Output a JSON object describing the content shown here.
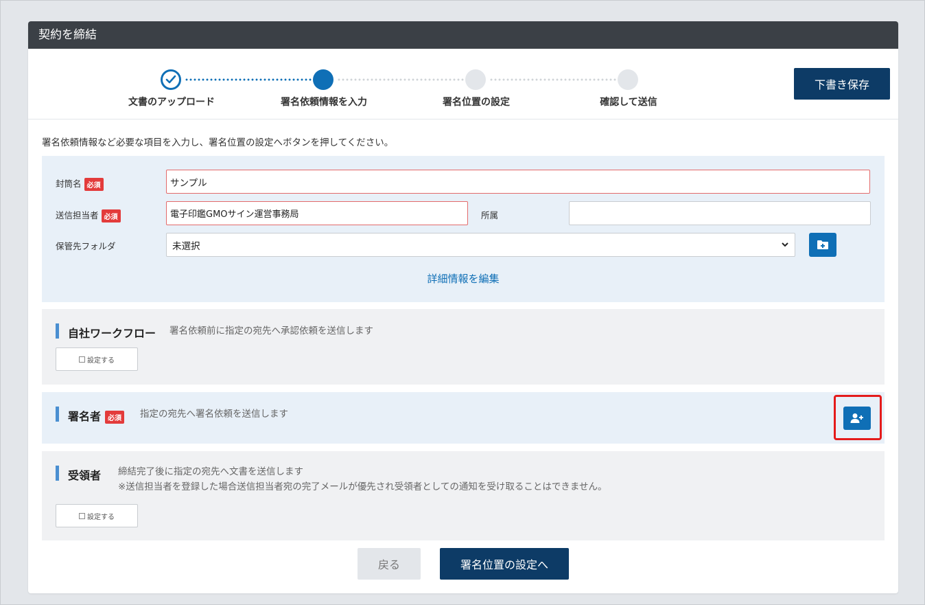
{
  "window": {
    "title": "契約を締結"
  },
  "stepper": {
    "steps": [
      {
        "label": "文書のアップロード",
        "state": "done"
      },
      {
        "label": "署名依頼情報を入力",
        "state": "active"
      },
      {
        "label": "署名位置の設定",
        "state": "pending"
      },
      {
        "label": "確認して送信",
        "state": "pending"
      }
    ]
  },
  "toolbar": {
    "draft_save_label": "下書き保存"
  },
  "instruction": "署名依頼情報など必要な項目を入力し、署名位置の設定へボタンを押してください。",
  "form": {
    "envelope_name": {
      "label": "封筒名",
      "required_badge": "必須",
      "value": "サンプル"
    },
    "sender": {
      "label": "送信担当者",
      "required_badge": "必須",
      "value": "電子印鑑GMOサイン運営事務局"
    },
    "affiliation": {
      "label": "所属",
      "value": ""
    },
    "storage_folder": {
      "label": "保管先フォルダ",
      "selected": "未選択"
    },
    "edit_details_link": "詳細情報を編集"
  },
  "sections": {
    "workflow": {
      "title": "自社ワークフロー",
      "description": "署名依頼前に指定の宛先へ承認依頼を送信します",
      "set_button": "設定する"
    },
    "signers": {
      "title": "署名者",
      "required_badge": "必須",
      "description": "指定の宛先へ署名依頼を送信します"
    },
    "recipients": {
      "title": "受領者",
      "description_line1": "締結完了後に指定の宛先へ文書を送信します",
      "description_line2": "※送信担当者を登録した場合送信担当者宛の完了メールが優先され受領者としての通知を受け取ることはできません。",
      "set_button": "設定する"
    }
  },
  "footer": {
    "back_label": "戻る",
    "next_label": "署名位置の設定へ"
  },
  "colors": {
    "primary": "#0f6fb6",
    "dark_navy": "#0d3b66",
    "required": "#e33b3b",
    "highlight": "#e41b1b"
  }
}
